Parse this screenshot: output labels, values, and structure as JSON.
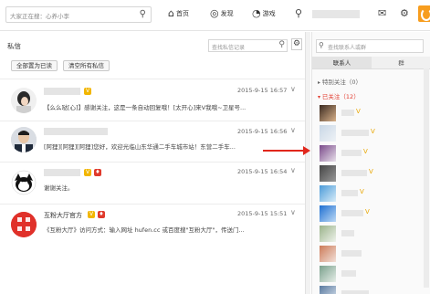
{
  "topbar": {
    "search_placeholder": "大家正在搜：心养小李",
    "nav": [
      {
        "icon": "home-icon",
        "glyph": "⌂",
        "label": "首页"
      },
      {
        "icon": "discover-icon",
        "glyph": "◎",
        "label": "发现"
      },
      {
        "icon": "game-icon",
        "glyph": "◔",
        "label": "游戏"
      }
    ],
    "user_icon": "user-icon",
    "mail_icon": "mail-icon",
    "settings_icon": "gear-icon"
  },
  "messages_panel": {
    "title": "私信",
    "search_placeholder": "查找私信记录",
    "buttons": [
      {
        "label": "全部置为已读"
      },
      {
        "label": "清空所有私信"
      }
    ],
    "conversations": [
      {
        "time": "2015-9-15 16:57",
        "text": "【么么哒[心]】感谢关注，这是一条自动回复哦！[太开心]来V我哦~卫星号..."
      },
      {
        "time": "2015-9-15 16:56",
        "text": "[阿狸][阿狸][阿狸]您好，欢迎光临山东华通二手车城市站！东营二手车..."
      },
      {
        "time": "2015-9-15 16:54",
        "text": "谢谢关注。"
      },
      {
        "name": "互粉大厅官方",
        "time": "2015-9-15 15:51",
        "text": "《互粉大厅》访问方式：输入网址 hufen.cc 或百度搜\"互粉大厅\"，传送门..."
      }
    ]
  },
  "contacts_panel": {
    "search_placeholder": "查找联系人或群",
    "tabs": [
      "联系人",
      "群"
    ],
    "groups": [
      {
        "label": "特别关注（0）"
      },
      {
        "label": "已关注（12）"
      }
    ],
    "contacts": [
      {
        "colors": [
          "#3a2a20",
          "#d8b18a"
        ]
      },
      {
        "colors": [
          "#c9d7e6",
          "#eef2f6"
        ]
      },
      {
        "colors": [
          "#7a4a8a",
          "#e8e0ea"
        ]
      },
      {
        "colors": [
          "#444444",
          "#999999"
        ]
      },
      {
        "colors": [
          "#4a9ad8",
          "#d8ecf8"
        ]
      },
      {
        "colors": [
          "#1f6fd1",
          "#bcd9f5"
        ]
      },
      {
        "colors": [
          "#9ab38a",
          "#eef2ea"
        ]
      },
      {
        "colors": [
          "#cc7a58",
          "#f2e0d8"
        ]
      },
      {
        "colors": [
          "#7aa08c",
          "#e6eee8"
        ]
      },
      {
        "colors": [
          "#5a7aa0",
          "#dbe4ee"
        ]
      }
    ]
  },
  "colors": {
    "accent_red": "#e1271c",
    "verified_gold": "#f2b600",
    "orange_logo": "#f79d1e"
  }
}
